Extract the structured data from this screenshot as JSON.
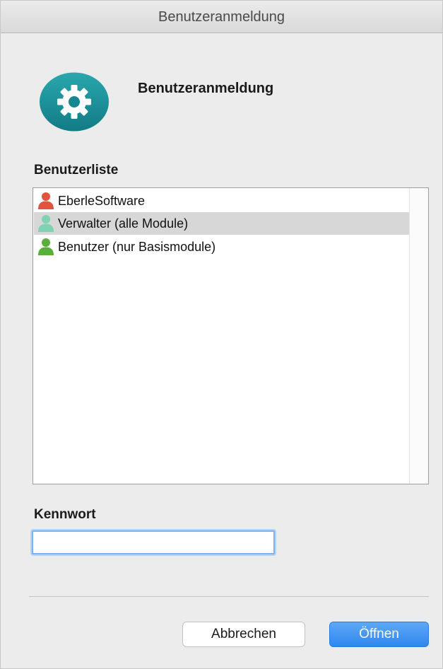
{
  "window": {
    "title": "Benutzeranmeldung"
  },
  "header": {
    "title": "Benutzeranmeldung",
    "icon": "gear-icon",
    "icon_color": "#1e8f99"
  },
  "user_list": {
    "label": "Benutzerliste",
    "items": [
      {
        "label": "EberleSoftware",
        "icon": "user-icon",
        "icon_color": "#e0533f",
        "selected": false
      },
      {
        "label": "Verwalter (alle Module)",
        "icon": "user-icon",
        "icon_color": "#7fd2b2",
        "selected": true
      },
      {
        "label": "Benutzer (nur Basismodule)",
        "icon": "user-icon",
        "icon_color": "#5aae3a",
        "selected": false
      }
    ]
  },
  "password": {
    "label": "Kennwort",
    "value": "",
    "placeholder": ""
  },
  "buttons": {
    "cancel": "Abbrechen",
    "open": "Öffnen"
  },
  "colors": {
    "accent": "#3b8ff2",
    "selection": "#d7d7d7"
  }
}
